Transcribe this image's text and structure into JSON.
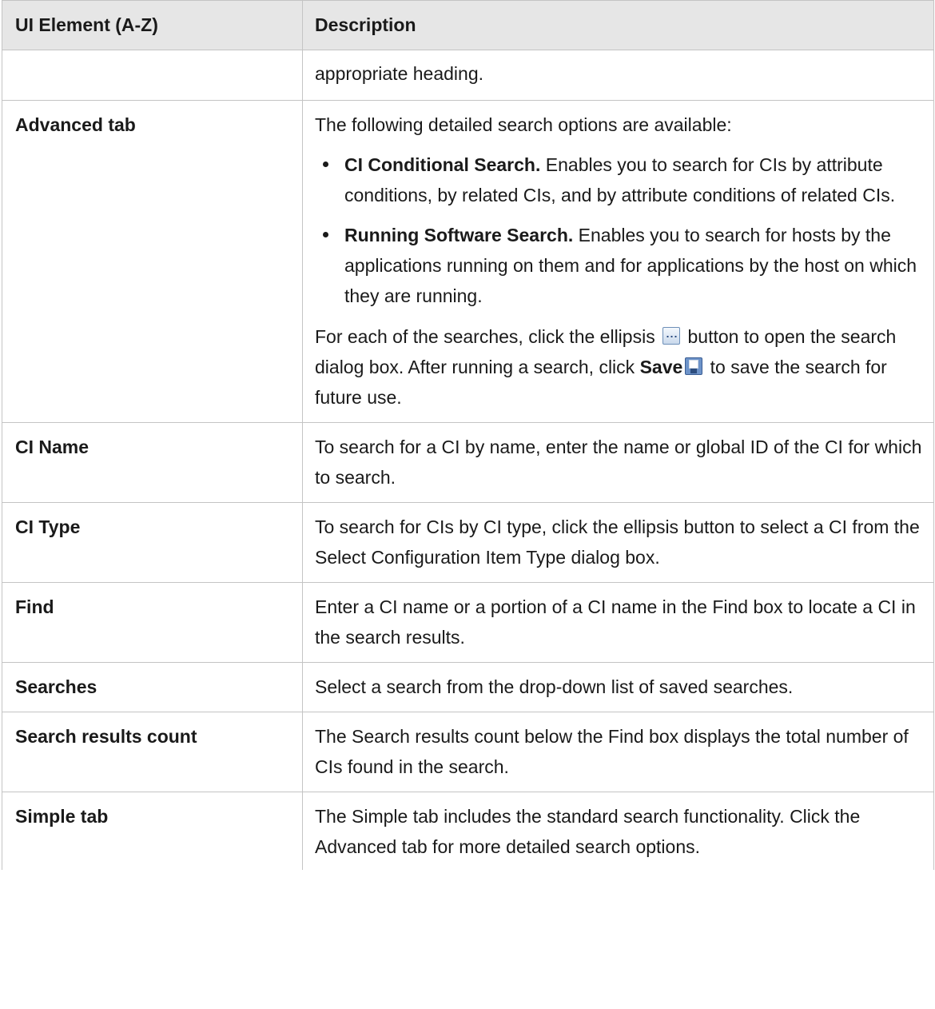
{
  "table": {
    "header": {
      "element": "UI Element (A-Z)",
      "description": "Description"
    },
    "continuation_text": "appropriate heading.",
    "advanced": {
      "name": "Advanced tab",
      "intro": "The following detailed search options are available:",
      "options": [
        {
          "title": "CI Conditional Search.",
          "text": " Enables you to search for CIs by attribute conditions, by related CIs, and by attribute conditions of related CIs."
        },
        {
          "title": "Running Software Search.",
          "text": " Enables you to search for hosts by the applications running on them and for applications by the host on which they are running."
        }
      ],
      "note_part1": "For each of the searches, click the ellipsis ",
      "note_part2": " button to open the search dialog box. After running a search, click ",
      "note_save": "Save",
      "note_part3": " to save the search for future use.",
      "icons": {
        "ellipsis": "ellipsis-button-icon",
        "save": "save-disk-icon"
      }
    },
    "rows": [
      {
        "name": "CI Name",
        "description": "To search for a CI by name, enter the name or global ID of the CI for which to search."
      },
      {
        "name": "CI Type",
        "description": "To search for CIs by CI type, click the ellipsis button to select a CI from the Select Configuration Item Type dialog box."
      },
      {
        "name": "Find",
        "description": "Enter a CI name or a portion of a CI name in the Find box to locate a CI in the search results."
      },
      {
        "name": "Searches",
        "description": "Select a search from the drop-down list of saved searches."
      },
      {
        "name": "Search results count",
        "description": "The Search results count below the Find box displays the total number of CIs found in the search."
      },
      {
        "name": "Simple tab",
        "description": "The Simple tab includes the standard search functionality. Click the Advanced tab for more detailed search options."
      }
    ],
    "colors": {
      "header_bg": "#e6e6e6",
      "border": "#c4c4c4",
      "text": "#1a1a1a"
    }
  }
}
